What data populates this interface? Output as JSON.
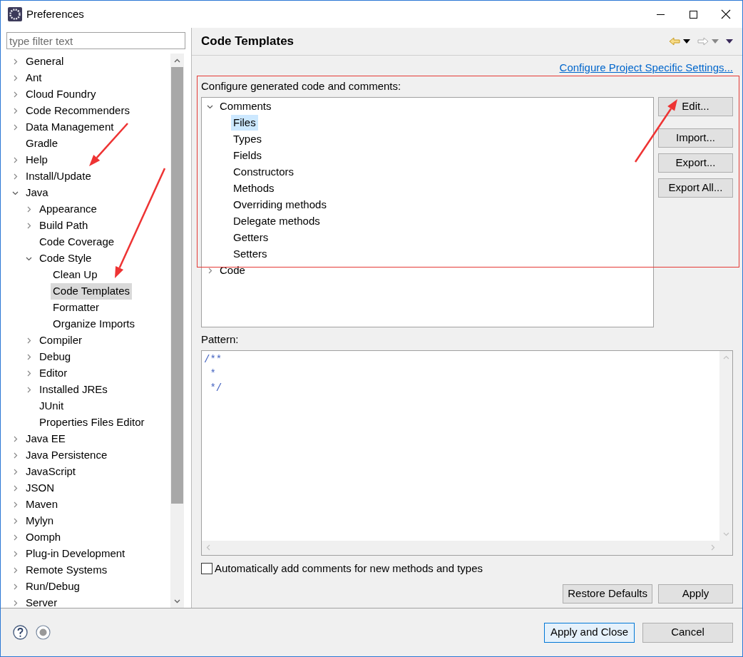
{
  "window": {
    "title": "Preferences"
  },
  "filter": {
    "placeholder": "type filter text"
  },
  "tree": [
    {
      "label": "General",
      "kind": "folder",
      "expanded": false,
      "selected": false
    },
    {
      "label": "Ant",
      "kind": "folder",
      "expanded": false,
      "selected": false
    },
    {
      "label": "Cloud Foundry",
      "kind": "folder",
      "expanded": false,
      "selected": false
    },
    {
      "label": "Code Recommenders",
      "kind": "folder",
      "expanded": false,
      "selected": false
    },
    {
      "label": "Data Management",
      "kind": "folder",
      "expanded": false,
      "selected": false
    },
    {
      "label": "Gradle",
      "kind": "leaf",
      "selected": false
    },
    {
      "label": "Help",
      "kind": "folder",
      "expanded": false,
      "selected": false
    },
    {
      "label": "Install/Update",
      "kind": "folder",
      "expanded": false,
      "selected": false
    },
    {
      "label": "Java",
      "kind": "folder",
      "expanded": true,
      "selected": false,
      "children": [
        {
          "label": "Appearance",
          "kind": "folder",
          "expanded": false,
          "selected": false
        },
        {
          "label": "Build Path",
          "kind": "folder",
          "expanded": false,
          "selected": false
        },
        {
          "label": "Code Coverage",
          "kind": "leaf",
          "selected": false
        },
        {
          "label": "Code Style",
          "kind": "folder",
          "expanded": true,
          "selected": false,
          "children": [
            {
              "label": "Clean Up",
              "kind": "leaf",
              "selected": false
            },
            {
              "label": "Code Templates",
              "kind": "leaf",
              "selected": true
            },
            {
              "label": "Formatter",
              "kind": "leaf",
              "selected": false
            },
            {
              "label": "Organize Imports",
              "kind": "leaf",
              "selected": false
            }
          ]
        },
        {
          "label": "Compiler",
          "kind": "folder",
          "expanded": false,
          "selected": false
        },
        {
          "label": "Debug",
          "kind": "folder",
          "expanded": false,
          "selected": false
        },
        {
          "label": "Editor",
          "kind": "folder",
          "expanded": false,
          "selected": false
        },
        {
          "label": "Installed JREs",
          "kind": "folder",
          "expanded": false,
          "selected": false
        },
        {
          "label": "JUnit",
          "kind": "leaf",
          "selected": false
        },
        {
          "label": "Properties Files Editor",
          "kind": "leaf",
          "selected": false
        }
      ]
    },
    {
      "label": "Java EE",
      "kind": "folder",
      "expanded": false,
      "selected": false
    },
    {
      "label": "Java Persistence",
      "kind": "folder",
      "expanded": false,
      "selected": false
    },
    {
      "label": "JavaScript",
      "kind": "folder",
      "expanded": false,
      "selected": false
    },
    {
      "label": "JSON",
      "kind": "folder",
      "expanded": false,
      "selected": false
    },
    {
      "label": "Maven",
      "kind": "folder",
      "expanded": false,
      "selected": false
    },
    {
      "label": "Mylyn",
      "kind": "folder",
      "expanded": false,
      "selected": false
    },
    {
      "label": "Oomph",
      "kind": "folder",
      "expanded": false,
      "selected": false
    },
    {
      "label": "Plug-in Development",
      "kind": "folder",
      "expanded": false,
      "selected": false
    },
    {
      "label": "Remote Systems",
      "kind": "folder",
      "expanded": false,
      "selected": false
    },
    {
      "label": "Run/Debug",
      "kind": "folder",
      "expanded": false,
      "selected": false
    },
    {
      "label": "Server",
      "kind": "folder",
      "expanded": false,
      "selected": false
    }
  ],
  "page": {
    "title": "Code Templates",
    "link": "Configure Project Specific Settings...",
    "intro": "Configure generated code and comments:",
    "templates": [
      {
        "label": "Comments",
        "expanded": true,
        "selected": false,
        "children": [
          {
            "label": "Files",
            "selected": true
          },
          {
            "label": "Types",
            "selected": false
          },
          {
            "label": "Fields",
            "selected": false
          },
          {
            "label": "Constructors",
            "selected": false
          },
          {
            "label": "Methods",
            "selected": false
          },
          {
            "label": "Overriding methods",
            "selected": false
          },
          {
            "label": "Delegate methods",
            "selected": false
          },
          {
            "label": "Getters",
            "selected": false
          },
          {
            "label": "Setters",
            "selected": false
          }
        ]
      },
      {
        "label": "Code",
        "expanded": false,
        "selected": false
      }
    ],
    "side_buttons": [
      "Edit...",
      "Import...",
      "Export...",
      "Export All..."
    ],
    "pattern_label": "Pattern:",
    "pattern": [
      "/**",
      " *",
      " */"
    ],
    "auto_comments": {
      "label": "Automatically add comments for new methods and types",
      "checked": false
    },
    "buttons": [
      "Restore Defaults",
      "Apply"
    ]
  },
  "footer": {
    "buttons": [
      {
        "label": "Apply and Close",
        "selected": true
      },
      {
        "label": "Cancel",
        "selected": false
      }
    ]
  }
}
